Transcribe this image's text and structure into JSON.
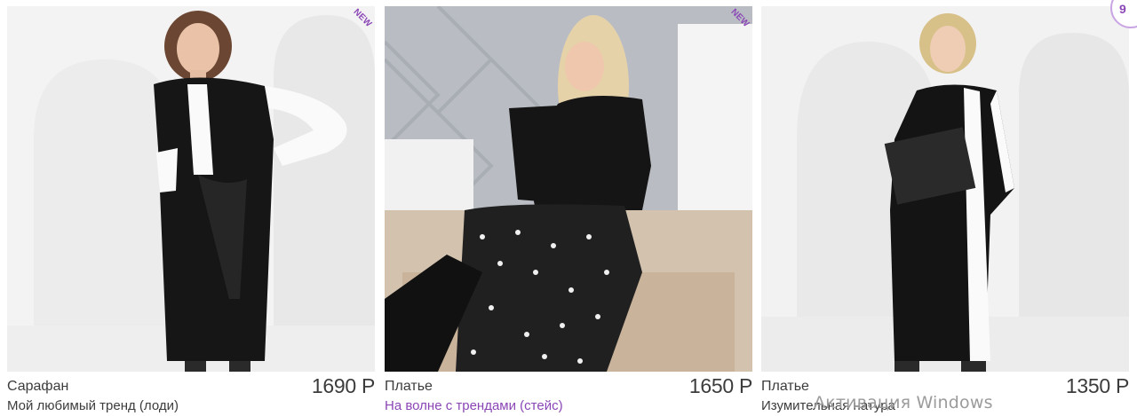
{
  "badge_new": "NEW",
  "top_right_badge": "9",
  "products": [
    {
      "category": "Сарафан",
      "price": "1690 Р",
      "name": "Мой любимый тренд (лоди)"
    },
    {
      "category": "Платье",
      "price": "1650 Р",
      "name": "На волне с трендами (стейс)"
    },
    {
      "category": "Платье",
      "price": "1350 Р",
      "name": "Изумительная натура"
    }
  ],
  "watermark": "Активация Windows",
  "colors": {
    "accent": "#8b46b6",
    "text": "#3c3c3c",
    "watermark": "#9b9b9b"
  }
}
